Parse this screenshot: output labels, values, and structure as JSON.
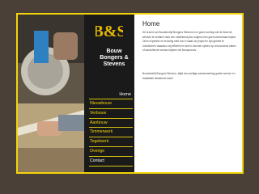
{
  "logo": {
    "monogram": "B&S",
    "line1": "Bouw",
    "line2": "Bongers & Stevens"
  },
  "nav": {
    "active": "Home",
    "items": [
      "Nieuwbouw",
      "Verbouw",
      "Aanbouw",
      "Timmerwerk",
      "Tegelwerk",
      "Overige",
      "Contact"
    ]
  },
  "content": {
    "title": "Home",
    "paragraph1": "De kracht van Bouwbedrijf Bongers Stevens is in goed overleg met de klant de wensen te vertalen naar een uitstekend plan volgens een goed uitvoerbaar traject. Onze expertise en ervaring stelt ons in staat uw project in zijn geheel te coördineren waardoor wij efficiënt en snel in kunnen spelen op onvoorziene zaken of aanvullende wensen tijdens het bouwproces.",
    "paragraph2": "Bouwbedrijf Bongers Stevens, altijd een prettige samenwerking goede service en kwalitatief uitstekend werk!"
  },
  "colors": {
    "accent": "#f2d40a",
    "sidebar": "#1a1a1a",
    "background": "#4a4038"
  }
}
